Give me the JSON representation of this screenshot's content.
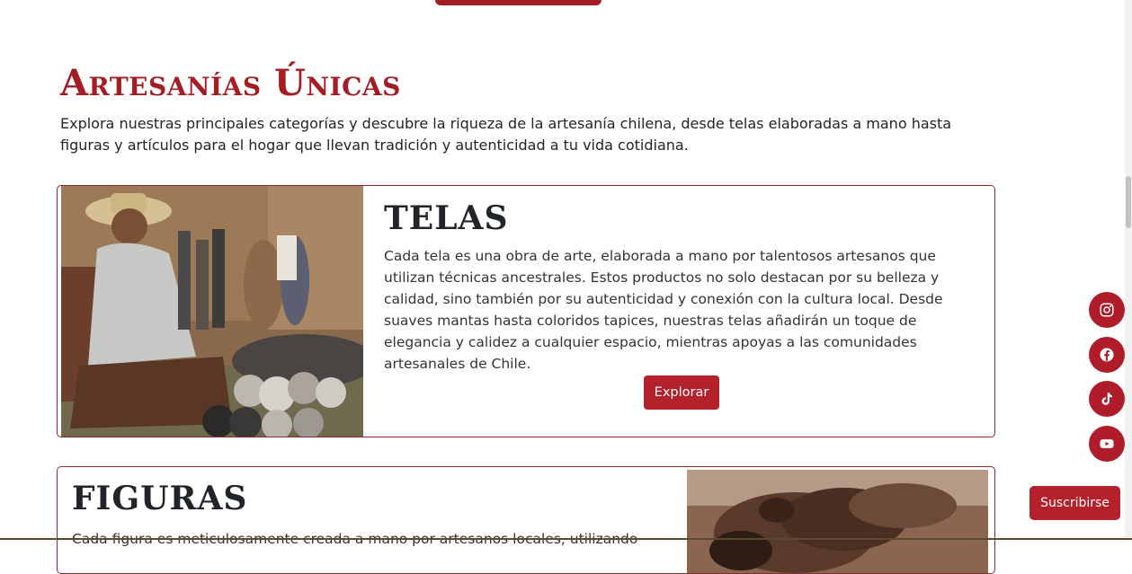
{
  "section": {
    "title": "Artesanías Únicas",
    "intro": "Explora nuestras principales categorías y descubre la riqueza de la artesanía chilena, desde telas elaboradas a mano hasta figuras y artículos para el hogar que llevan tradición y autenticidad a tu vida cotidiana."
  },
  "cards": [
    {
      "title": "TELAS",
      "text": "Cada tela es una obra de arte, elaborada a mano por talentosos artesanos que utilizan técnicas ancestrales. Estos productos no solo destacan por su belleza y calidad, sino también por su autenticidad y conexión con la cultura local. Desde suaves mantas hasta coloridos tapices, nuestras telas añadirán un toque de elegancia y calidez a cualquier espacio, mientras apoyas a las comunidades artesanales de Chile.",
      "button": "Explorar"
    },
    {
      "title": "FIGURAS",
      "text": "Cada figura es meticulosamente creada a mano por artesanos locales, utilizando"
    }
  ],
  "social": [
    "instagram-icon",
    "facebook-icon",
    "tiktok-icon",
    "youtube-icon"
  ],
  "subscribe": "Suscribirse",
  "colors": {
    "accent": "#a51d24",
    "button": "#b3212b",
    "social": "#b11c2a",
    "card_border": "#8e2a2e"
  }
}
